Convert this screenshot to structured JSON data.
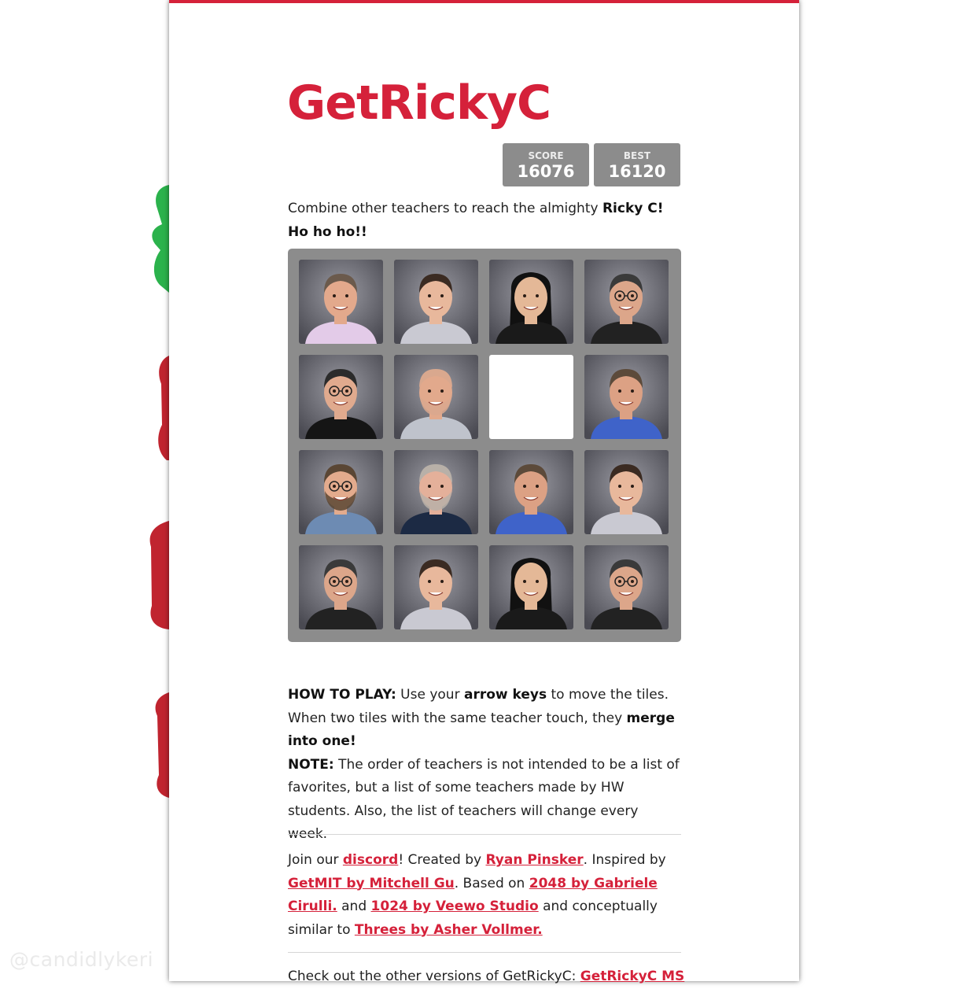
{
  "watermark": "@candidlykeri",
  "game": {
    "title": "GetRickyC",
    "score": {
      "label": "SCORE",
      "value": "16076"
    },
    "best": {
      "label": "BEST",
      "value": "16120"
    },
    "accent_color": "#d5213a",
    "board_color": "#8c8c8c"
  },
  "intro": {
    "text": "Combine other teachers to reach the almighty ",
    "bold": "Ricky C! Ho ho ho!!"
  },
  "board": {
    "size": 4,
    "tiles": [
      {
        "kind": "teacher-1"
      },
      {
        "kind": "teacher-2"
      },
      {
        "kind": "teacher-3"
      },
      {
        "kind": "teacher-4"
      },
      {
        "kind": "teacher-5"
      },
      {
        "kind": "teacher-6"
      },
      {
        "kind": "empty"
      },
      {
        "kind": "teacher-7"
      },
      {
        "kind": "teacher-8"
      },
      {
        "kind": "teacher-9"
      },
      {
        "kind": "teacher-7"
      },
      {
        "kind": "teacher-2"
      },
      {
        "kind": "teacher-4"
      },
      {
        "kind": "teacher-2"
      },
      {
        "kind": "teacher-3"
      },
      {
        "kind": "teacher-4"
      }
    ]
  },
  "how_to_play": {
    "heading": "HOW TO PLAY:",
    "text1": " Use your ",
    "bold1": "arrow keys",
    "text2": " to move the tiles. When two tiles with the same teacher touch, they ",
    "bold2": "merge into one!",
    "note_heading": "NOTE:",
    "note_text": " The order of teachers is not intended to be a list of favorites, but a list of some teachers made by HW students. Also, the list of teachers will change every week."
  },
  "credits": {
    "t1": "Join our ",
    "discord": "discord",
    "t2": "! Created by ",
    "author": "Ryan Pinsker",
    "t3": ". Inspired by ",
    "getmit": "GetMIT by Mitchell Gu",
    "t4": ". Based on ",
    "g2048": "2048 by Gabriele Cirulli.",
    "t5": " and ",
    "g1024": "1024 by Veewo Studio",
    "t6": " and conceptually similar to ",
    "threes": "Threes by Asher Vollmer."
  },
  "other_versions": {
    "text": "Check out the other versions of GetRickyC: ",
    "link": "GetRickyC MS"
  }
}
